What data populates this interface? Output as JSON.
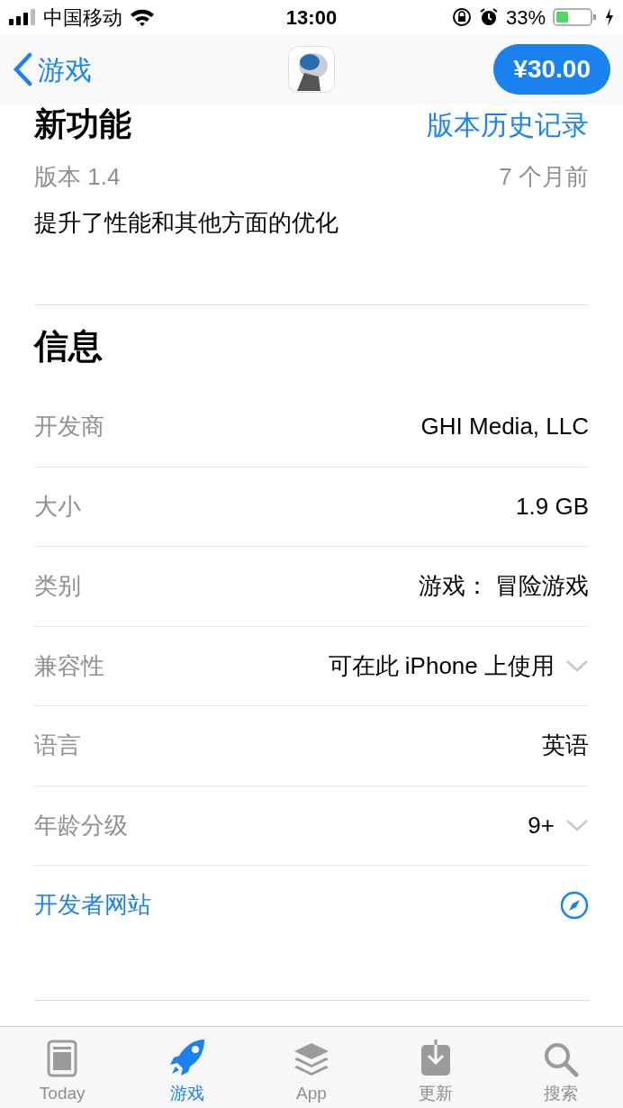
{
  "status_bar": {
    "carrier": "中国移动",
    "time": "13:00",
    "battery": "33%"
  },
  "nav": {
    "back": "游戏",
    "price": "¥30.00"
  },
  "whats_new": {
    "title": "新功能",
    "history_link": "版本历史记录",
    "version": "版本 1.4",
    "age": "7 个月前",
    "notes": "提升了性能和其他方面的优化"
  },
  "info": {
    "title": "信息",
    "rows": [
      {
        "kind": "plain",
        "label": "开发商",
        "value": "GHI Media, LLC"
      },
      {
        "kind": "plain",
        "label": "大小",
        "value": "1.9 GB"
      },
      {
        "kind": "plain",
        "label": "类别",
        "value": "游戏： 冒险游戏"
      },
      {
        "kind": "expand",
        "label": "兼容性",
        "value": "可在此 iPhone 上使用"
      },
      {
        "kind": "plain",
        "label": "语言",
        "value": "英语"
      },
      {
        "kind": "expand",
        "label": "年龄分级",
        "value": "9+"
      },
      {
        "kind": "link",
        "label": "开发者网站"
      }
    ]
  },
  "tab_bar": [
    {
      "label": "Today",
      "kind": "today",
      "selected": false
    },
    {
      "label": "游戏",
      "kind": "games",
      "selected": true
    },
    {
      "label": "App",
      "kind": "apps",
      "selected": false
    },
    {
      "label": "更新",
      "kind": "updates",
      "selected": false
    },
    {
      "label": "搜索",
      "kind": "search",
      "selected": false
    }
  ]
}
